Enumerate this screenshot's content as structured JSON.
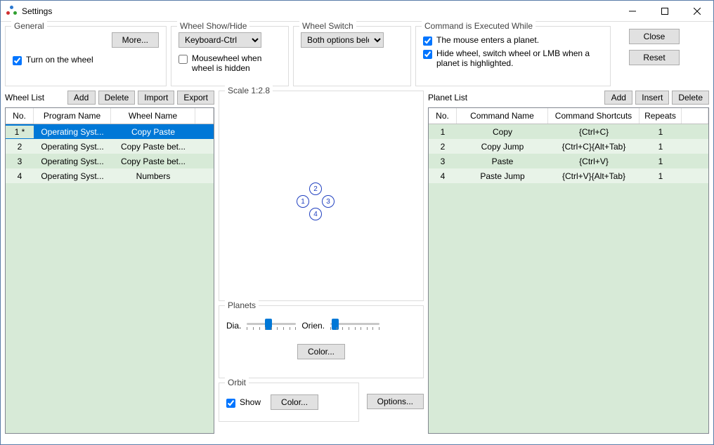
{
  "window": {
    "title": "Settings"
  },
  "buttons": {
    "close": "Close",
    "reset": "Reset",
    "more": "More...",
    "add": "Add",
    "delete": "Delete",
    "import": "Import",
    "export": "Export",
    "insert": "Insert",
    "color": "Color...",
    "options": "Options..."
  },
  "groups": {
    "general": "General",
    "showhide": "Wheel Show/Hide",
    "switch": "Wheel Switch",
    "exec": "Command is Executed While",
    "wheel_list": "Wheel List",
    "planet_list": "Planet List",
    "scale": "Scale 1:2.8",
    "planets": "Planets",
    "orbit": "Orbit"
  },
  "general": {
    "turn_on": "Turn on the wheel"
  },
  "showhide": {
    "selected": "Keyboard-Ctrl",
    "mousewheel_hidden": "Mousewheel when wheel is hidden"
  },
  "switch": {
    "selected": "Both options below"
  },
  "exec": {
    "mouse_enters": "The mouse enters a planet.",
    "hide_wheel": "Hide wheel, switch wheel or LMB when a planet is highlighted."
  },
  "wheel_list": {
    "headers": [
      "No.",
      "Program Name",
      "Wheel Name"
    ],
    "rows": [
      {
        "no": "1 *",
        "program": "Operating Syst...",
        "wheel": "Copy Paste",
        "selected": true
      },
      {
        "no": "2",
        "program": "Operating Syst...",
        "wheel": "Copy Paste bet...",
        "selected": false
      },
      {
        "no": "3",
        "program": "Operating Syst...",
        "wheel": "Copy Paste bet...",
        "selected": false
      },
      {
        "no": "4",
        "program": "Operating Syst...",
        "wheel": "Numbers",
        "selected": false
      }
    ]
  },
  "planet_list": {
    "headers": [
      "No.",
      "Command Name",
      "Command Shortcuts",
      "Repeats"
    ],
    "rows": [
      {
        "no": "1",
        "cmd": "Copy",
        "short": "{Ctrl+C}",
        "rep": "1"
      },
      {
        "no": "2",
        "cmd": "Copy Jump",
        "short": "{Ctrl+C}{Alt+Tab}",
        "rep": "1"
      },
      {
        "no": "3",
        "cmd": "Paste",
        "short": "{Ctrl+V}",
        "rep": "1"
      },
      {
        "no": "4",
        "cmd": "Paste Jump",
        "short": "{Ctrl+V}{Alt+Tab}",
        "rep": "1"
      }
    ]
  },
  "planets_panel": {
    "dia": "Dia.",
    "orien": "Orien."
  },
  "orbit_panel": {
    "show": "Show"
  },
  "preview_nodes": [
    "1",
    "2",
    "3",
    "4"
  ]
}
